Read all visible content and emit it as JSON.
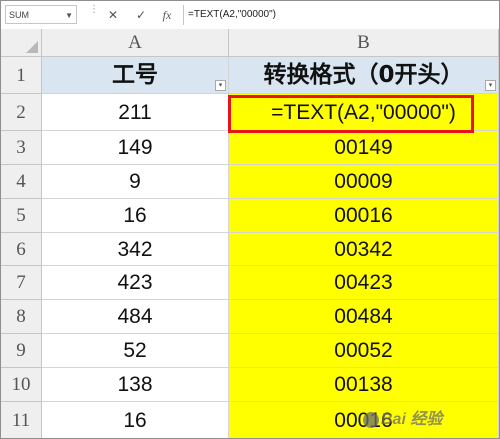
{
  "formula_bar": {
    "name_box": "SUM",
    "cancel_icon": "✕",
    "enter_icon": "✓",
    "fx_label": "fx",
    "formula": "=TEXT(A2,\"00000\")"
  },
  "columns": [
    "A",
    "B"
  ],
  "rows": [
    "1",
    "2",
    "3",
    "4",
    "5",
    "6",
    "7",
    "8",
    "9",
    "10",
    "11"
  ],
  "header": {
    "a": "工号",
    "b": "转换格式（0开头）"
  },
  "data": [
    {
      "a": "211",
      "b": "=TEXT(A2,\"00000\")"
    },
    {
      "a": "149",
      "b": "00149"
    },
    {
      "a": "9",
      "b": "00009"
    },
    {
      "a": "16",
      "b": "00016"
    },
    {
      "a": "342",
      "b": "00342"
    },
    {
      "a": "423",
      "b": "00423"
    },
    {
      "a": "484",
      "b": "00484"
    },
    {
      "a": "52",
      "b": "00052"
    },
    {
      "a": "138",
      "b": "00138"
    },
    {
      "a": "16",
      "b": "00016"
    }
  ],
  "colors": {
    "header_fill": "#d9e6f2",
    "highlight_fill": "#ffff00",
    "selection_border": "#e8131b"
  },
  "watermark": "Bai 经验"
}
